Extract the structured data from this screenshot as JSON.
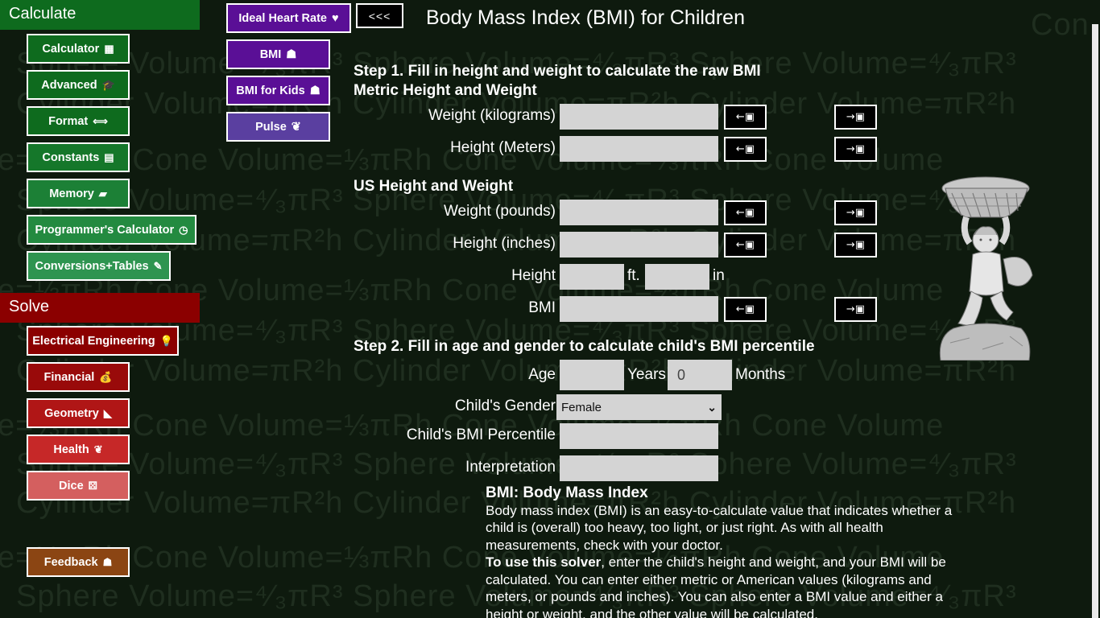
{
  "watermark_lines": [
    "Sphere Volume=⁴⁄₃πR³ Sphere Volume=⁴⁄₃πR³ Sphere Volume=⁴⁄₃πR³",
    "Cylinder Volume=πR²h Cylinder Volume=πR²h Cylinder Volume=πR²h",
    "Cone Volume=⅓πRh Cone Volume=⅓πRh Cone Volume=⅓πRh Cone Volume"
  ],
  "nav": {
    "calculate_header": "Calculate",
    "solve_header": "Solve",
    "calculate_items": [
      {
        "label": "Calculator",
        "icon": "calculator-icon",
        "glyph": "▦"
      },
      {
        "label": "Advanced",
        "icon": "graduation-cap-icon",
        "glyph": "🎓"
      },
      {
        "label": "Format",
        "icon": "left-right-arrow-icon",
        "glyph": "⟺"
      },
      {
        "label": "Constants",
        "icon": "list-icon",
        "glyph": "▤"
      },
      {
        "label": "Memory",
        "icon": "memory-card-icon",
        "glyph": "▰"
      },
      {
        "label": "Programmer's Calculator",
        "icon": "clock-icon",
        "glyph": "◷"
      },
      {
        "label": "Conversions+Tables",
        "icon": "pencil-icon",
        "glyph": "✎"
      }
    ],
    "solve_items": [
      {
        "label": "Electrical Engineering",
        "icon": "lightbulb-icon",
        "glyph": "💡"
      },
      {
        "label": "Financial",
        "icon": "money-bag-icon",
        "glyph": "💰"
      },
      {
        "label": "Geometry",
        "icon": "ruler-triangle-icon",
        "glyph": "◣"
      },
      {
        "label": "Health",
        "icon": "butterfly-icon",
        "glyph": "❦"
      },
      {
        "label": "Dice",
        "icon": "dice-icon",
        "glyph": "⚄"
      }
    ],
    "feedback": {
      "label": "Feedback",
      "icon": "feedback-person-icon",
      "glyph": "☗"
    }
  },
  "health_nav": {
    "ideal_heart_rate": "Ideal Heart Rate",
    "bmi": "BMI",
    "bmi_for_kids": "BMI for Kids",
    "pulse": "Pulse",
    "back": "<<<"
  },
  "title": "Body Mass Index (BMI) for Children",
  "step1": {
    "heading": "Step 1. Fill in height and weight to calculate the raw BMI",
    "metric_heading": "Metric Height and Weight",
    "weight_kg_label": "Weight (kilograms)",
    "height_m_label": "Height (Meters)",
    "us_heading": "US Height and Weight",
    "weight_lb_label": "Weight (pounds)",
    "height_in_label": "Height (inches)",
    "height_label": "Height",
    "ft_label": "ft.",
    "in_label": "in",
    "bmi_label": "BMI",
    "left_arrow": "←▣",
    "right_arrow": "→▣"
  },
  "step2": {
    "heading": "Step 2. Fill in age and gender to calculate child's BMI percentile",
    "age_label": "Age",
    "years_label": "Years",
    "months_value": "0",
    "months_label": "Months",
    "gender_label": "Child's Gender",
    "gender_value": "Female",
    "percentile_label": "Child's BMI Percentile",
    "interpretation_label": "Interpretation"
  },
  "info": {
    "heading": "BMI: Body Mass Index",
    "para1": "Body mass index (BMI) is an easy-to-calculate value that indicates whether a child is (overall) too heavy, too light, or just right. As with all health measurements, check with your doctor.",
    "para2_bold": "To use this solver",
    "para2_rest": ", enter the child's height and weight, and your BMI will be calculated. You can enter either metric or American values (kilograms and meters, or pounds and inches). You can also enter a BMI value and either a height or weight, and the other value will be calculated."
  },
  "colors": {
    "calculate_green": "#0e6b1e",
    "solve_red": "#8b0000",
    "health_purple": "#5a0f96",
    "feedback_brown": "#8b4513"
  }
}
